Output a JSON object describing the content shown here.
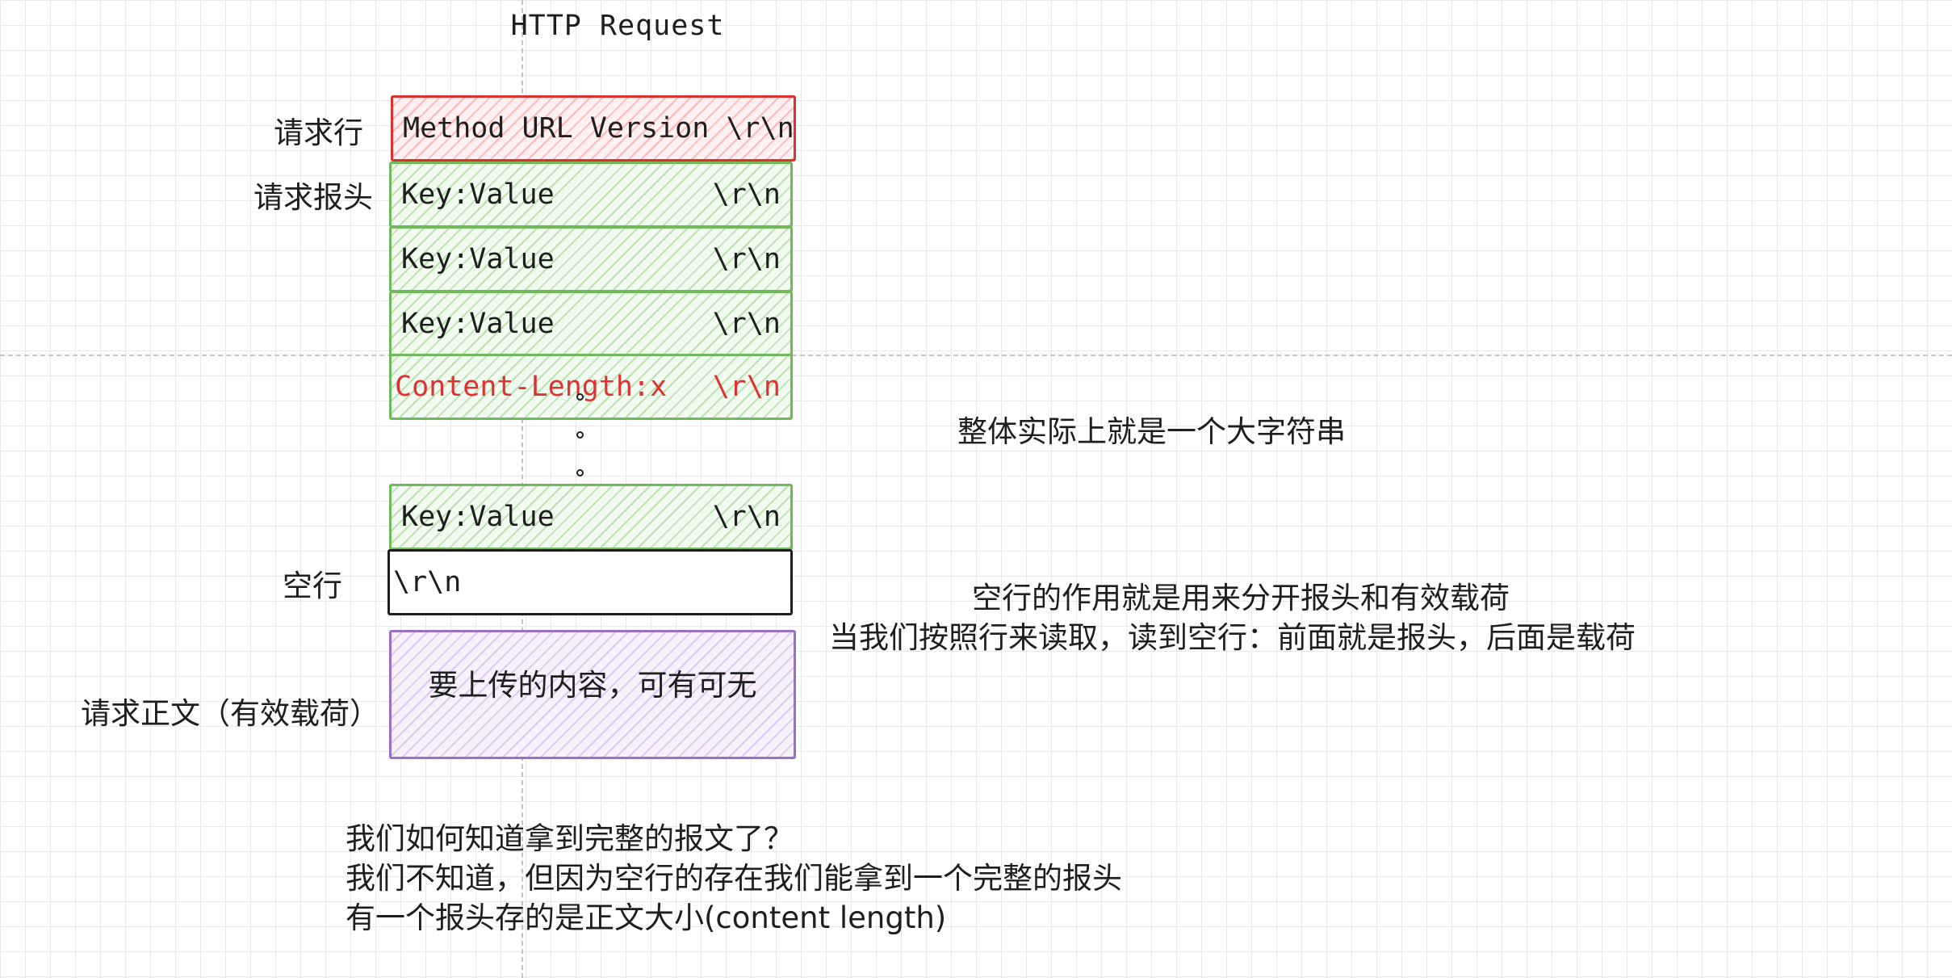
{
  "title": "HTTP Request",
  "labels": {
    "request_line": "请求行",
    "request_headers": "请求报头",
    "blank_line": "空行",
    "request_body": "请求正文（有效载荷）"
  },
  "request_line": {
    "text": "Method URL Version \\r\\n"
  },
  "headers": [
    {
      "key": "Key:Value",
      "crlf": "\\r\\n"
    },
    {
      "key": "Key:Value",
      "crlf": "\\r\\n"
    },
    {
      "key": "Key:Value",
      "crlf": "\\r\\n"
    },
    {
      "key": "Content-Length:x",
      "crlf": "\\r\\n"
    },
    {
      "key": "Key:Value",
      "crlf": "\\r\\n"
    }
  ],
  "blank_line": {
    "text": "\\r\\n"
  },
  "body": {
    "text": "要上传的内容，可有可无"
  },
  "notes": {
    "whole_string": "整体实际上就是一个大字符串",
    "blank_line_purpose": [
      "空行的作用就是用来分开报头和有效载荷",
      "当我们按照行来读取，读到空行：前面就是报头，后面是载荷"
    ],
    "complete_message": [
      "我们如何知道拿到完整的报文了？",
      "我们不知道，但因为空行的存在我们能拿到一个完整的报头",
      "有一个报头存的是正文大小(content length)"
    ]
  },
  "colors": {
    "request_line": "#e03131",
    "headers": "#6fb85b",
    "content_length_text": "#e03131",
    "body": "#9b6ec8",
    "blank_line": "#1e1e1e"
  }
}
